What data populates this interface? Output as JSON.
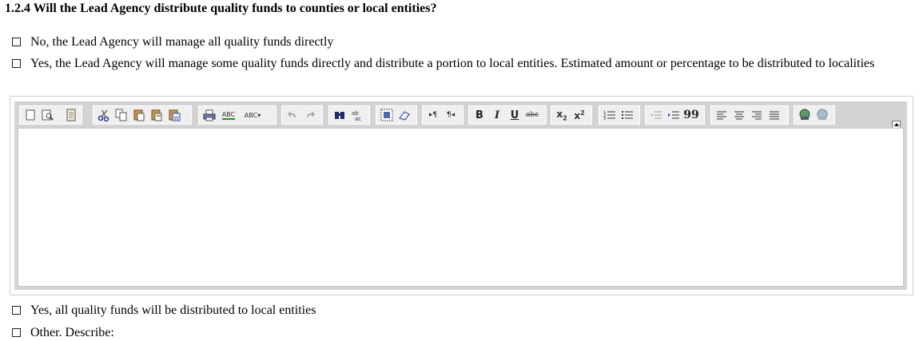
{
  "question": {
    "title": "1.2.4 Will the Lead Agency distribute quality funds to counties or local entities?"
  },
  "options": [
    {
      "label": "No, the Lead Agency will manage all quality funds directly",
      "checked": false
    },
    {
      "label": "Yes, the Lead Agency will manage some quality funds directly and distribute a portion to local entities. Estimated amount or percentage to be distributed to localities",
      "checked": false
    },
    {
      "label": "Yes, all quality funds will be distributed to local entities",
      "checked": false
    },
    {
      "label": "Other. Describe:",
      "checked": false
    }
  ],
  "editor": {
    "content": "",
    "toolbar_text": {
      "spell": "ABC",
      "spell2": "ABC▾",
      "bold": "B",
      "italic": "I",
      "underline": "U",
      "strike": "abc",
      "ltr": "▸¶",
      "rtl": "¶◂"
    },
    "toolbar_groups": [
      [
        "new-page-icon",
        "preview-icon",
        "templates-icon"
      ],
      [
        "cut-icon",
        "copy-icon",
        "paste-icon",
        "paste-text-icon",
        "paste-word-icon"
      ],
      [
        "print-icon",
        "spellcheck-icon",
        "spellcheck-menu-icon"
      ],
      [
        "undo-icon",
        "redo-icon"
      ],
      [
        "find-icon",
        "replace-icon"
      ],
      [
        "select-all-icon",
        "remove-format-icon"
      ],
      [
        "ltr-icon",
        "rtl-icon"
      ],
      [
        "bold-icon",
        "italic-icon",
        "underline-icon",
        "strikethrough-icon"
      ],
      [
        "subscript-icon",
        "superscript-icon"
      ],
      [
        "numbered-list-icon",
        "bulleted-list-icon"
      ],
      [
        "outdent-icon",
        "indent-icon",
        "blockquote-icon"
      ],
      [
        "align-left-icon",
        "align-center-icon",
        "align-right-icon",
        "justify-icon"
      ],
      [
        "link-icon",
        "unlink-icon"
      ]
    ]
  }
}
